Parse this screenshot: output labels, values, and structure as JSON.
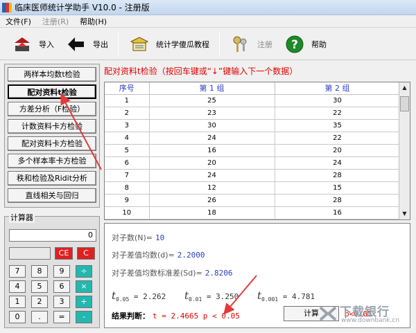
{
  "window": {
    "title": "临床医师统计学助手 V10.0 - 注册版"
  },
  "menu": [
    {
      "label": "文件(F)",
      "disabled": false
    },
    {
      "label": "注册(R)",
      "disabled": true
    },
    {
      "label": "帮助(H)",
      "disabled": false
    }
  ],
  "toolbar": {
    "import_label": "导入",
    "export_label": "导出",
    "tutorial_label": "统计学傻瓜教程",
    "register_label": "注册",
    "help_label": "帮助"
  },
  "left_buttons": [
    "两样本均数t检验",
    "配对资料t检验",
    "方差分析（F检验）",
    "计数资料卡方检验",
    "配对资料卡方检验",
    "多个样本率卡方检验",
    "秩和检验及Ridit分析",
    "直线相关与回归"
  ],
  "calculator": {
    "title": "计算器",
    "display": "0",
    "keys": {
      "ce": "CE",
      "c": "C",
      "k7": "7",
      "k8": "8",
      "k9": "9",
      "div": "÷",
      "k4": "4",
      "k5": "5",
      "k6": "6",
      "mul": "×",
      "k1": "1",
      "k2": "2",
      "k3": "3",
      "add": "+",
      "k0": "0",
      "dot": ".",
      "eq": "=",
      "sub": "-"
    }
  },
  "main": {
    "title": "配对资料t检验（按回车键或“↓”键输入下一个数据）",
    "columns": [
      "序号",
      "第 1 组",
      "第 2 组"
    ],
    "rows": [
      [
        "1",
        "25",
        "30"
      ],
      [
        "2",
        "23",
        "22"
      ],
      [
        "3",
        "30",
        "35"
      ],
      [
        "4",
        "24",
        "22"
      ],
      [
        "5",
        "16",
        "20"
      ],
      [
        "6",
        "20",
        "24"
      ],
      [
        "7",
        "24",
        "28"
      ],
      [
        "8",
        "12",
        "15"
      ],
      [
        "9",
        "26",
        "28"
      ],
      [
        "10",
        "18",
        "16"
      ]
    ]
  },
  "results": {
    "n_label": "对子数(N)=",
    "n_value": "10",
    "mean_label": "对子差值均数(d)=",
    "mean_value": "2.2000",
    "sd_label": "对子差值均数标准差(Sd)=",
    "sd_value": "2.8206",
    "t005_sub": "0.05",
    "t005_value": "= 2.262",
    "t001_sub": "0.01",
    "t001_value": "= 3.250",
    "t0001_sub": "0.001",
    "t0001_value": "= 4.781",
    "verdict_label": "结果判断：",
    "verdict_value": "t = 2.4665  p < 0.05",
    "calc_button": "计算",
    "p_note": "p<0.05"
  },
  "watermark": {
    "text": "下载银行",
    "url": "www.downbank.cn"
  },
  "colors": {
    "accent_red": "#e00000",
    "accent_blue": "#2a3fbf",
    "calc_red": "#e02020",
    "calc_teal": "#22b8b0"
  }
}
